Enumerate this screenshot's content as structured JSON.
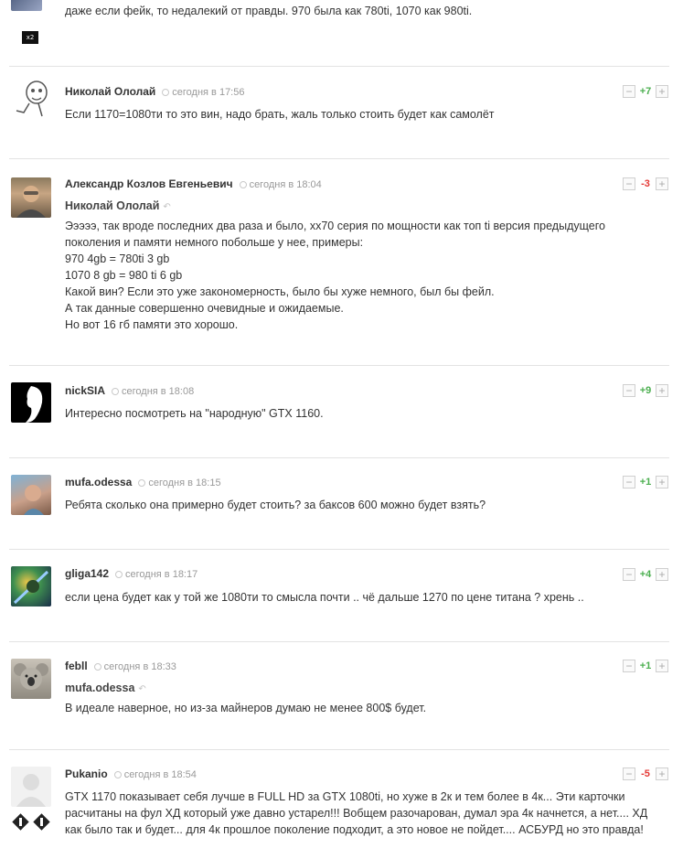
{
  "top": {
    "text": "даже если фейк, то недалекий от правды. 970 была как 780ti, 1070 как 980ti.",
    "badge": "x2"
  },
  "comments": [
    {
      "author": "Николай Ололай",
      "time": "сегодня в 17:56",
      "votes": "+7",
      "lines": [
        "Если 1170=1080ти то это вин, надо брать, жаль только стоить будет как самолёт"
      ]
    },
    {
      "author": "Александр Козлов Евгеньевич",
      "time": "сегодня в 18:04",
      "votes": "-3",
      "reply_to": "Николай Ололай",
      "lines": [
        "Эээээ, так вроде последних два раза и было, xx70 серия по мощности как топ ti версия предыдущего",
        "поколения и памяти немного побольше у нее, примеры:",
        "970 4gb = 780ti 3 gb",
        "1070 8 gb = 980 ti 6 gb",
        "Какой вин? Если это уже закономерность, было бы хуже немного, был бы фейл.",
        "А так данные совершенно очевидные и ожидаемые.",
        "Но вот 16 гб памяти это хорошо."
      ]
    },
    {
      "author": "nickSIA",
      "time": "сегодня в 18:08",
      "votes": "+9",
      "lines": [
        "Интересно посмотреть на \"народную\" GTX 1160."
      ]
    },
    {
      "author": "mufa.odessa",
      "time": "сегодня в 18:15",
      "votes": "+1",
      "lines": [
        "Ребята сколько она примерно будет стоить? за баксов 600 можно будет взять?"
      ]
    },
    {
      "author": "gliga142",
      "time": "сегодня в 18:17",
      "votes": "+4",
      "lines": [
        "если цена будет как у той же 1080ти то смысла почти .. чё дальше 1270 по цене титана ? хрень .."
      ]
    },
    {
      "author": "febll",
      "time": "сегодня в 18:33",
      "votes": "+1",
      "reply_to": "mufa.odessa",
      "lines": [
        "В идеале наверное, но из-за майнеров думаю не менее 800$ будет."
      ]
    },
    {
      "author": "Pukanio",
      "time": "сегодня в 18:54",
      "votes": "-5",
      "lines": [
        "GTX 1170 показывает себя лучше в FULL HD за GTX 1080ti, но хуже в 2к и тем более в 4к... Эти карточки",
        "расчитаны на фул ХД который уже давно устарел!!! Вобщем разочарован, думал эра 4к начнется, а нет.... ХД",
        "как было так и будет... для 4к прошлое поколение подходит, а это новое не пойдет.... АСБУРД но это правда!"
      ]
    }
  ],
  "vote_controls": {
    "minus": "−",
    "plus": "+"
  },
  "colors": {
    "positive": "#4caf50",
    "negative": "#e53935",
    "divider": "#e3e3e3"
  }
}
